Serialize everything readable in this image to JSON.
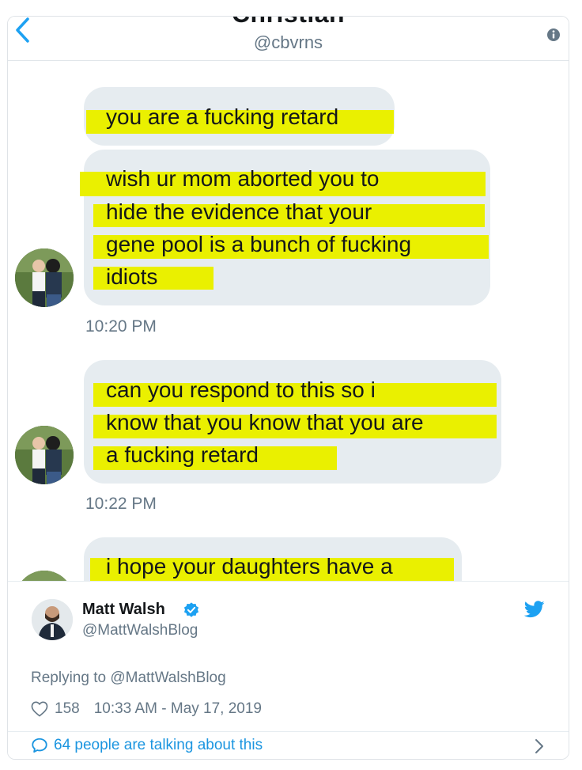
{
  "dm": {
    "contact_name": "Christian",
    "contact_handle": "@cbvrns",
    "messages": [
      {
        "lines": [
          "you are a fucking retard"
        ]
      },
      {
        "lines": [
          "wish ur mom aborted you to",
          "hide the evidence that your",
          "gene pool is a bunch of fucking",
          "idiots"
        ],
        "timestamp": "10:20 PM"
      },
      {
        "lines": [
          "can you respond to this so i",
          "know that you know that you are",
          "a fucking retard"
        ],
        "timestamp": "10:22 PM"
      },
      {
        "lines": [
          "i hope your daughters have a"
        ]
      }
    ],
    "highlight_color": "#eaf000",
    "bubble_color": "#e6ecf0"
  },
  "tweet": {
    "author_name": "Matt Walsh",
    "author_handle": "@MattWalshBlog",
    "replying_to": "Replying to @MattWalshBlog",
    "likes": "158",
    "datetime": "10:33 AM - May 17, 2019",
    "talking": "64 people are talking about this",
    "accent_color": "#1da1f2"
  }
}
